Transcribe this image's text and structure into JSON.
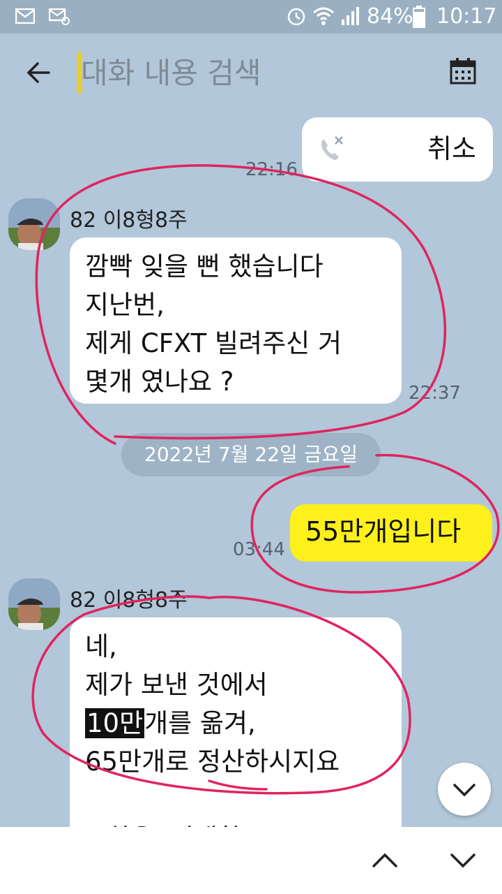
{
  "status_bar": {
    "battery": "84%",
    "time": "10:17",
    "icons": [
      "gmail-icon",
      "email-icon",
      "alarm-icon",
      "wifi-icon",
      "signal-icon",
      "battery-icon"
    ]
  },
  "header": {
    "search_placeholder": "대화 내용 검색",
    "search_value": "",
    "back_icon": "arrow-left-icon",
    "calendar_icon": "calendar-icon"
  },
  "chat": {
    "call_cancel": {
      "label": "취소",
      "time": "22:16",
      "icon": "missed-call-icon"
    },
    "msg1": {
      "sender": "82 이8형8주",
      "lines": [
        "깜빡 잊을 뻔 했습니다",
        "지난번,",
        "제게 CFXT 빌려주신 거",
        "몇개 였나요 ?"
      ],
      "time": "22:37"
    },
    "date_divider": "2022년 7월 22일 금요일",
    "my_msg": {
      "text": "55만개입니다",
      "time": "03:44"
    },
    "msg2": {
      "sender": "82 이8형8주",
      "line1": "네,",
      "line2": "제가 보낸 것에서",
      "line3_highlight": "10만",
      "line3_rest": "개를 옮겨,",
      "line4": "65만개로 정산하시지요",
      "line5": "* 최운, 기대함"
    }
  },
  "colors": {
    "background": "#b2c7d9",
    "my_bubble": "#fef01b",
    "annotation": "#e0245e"
  }
}
